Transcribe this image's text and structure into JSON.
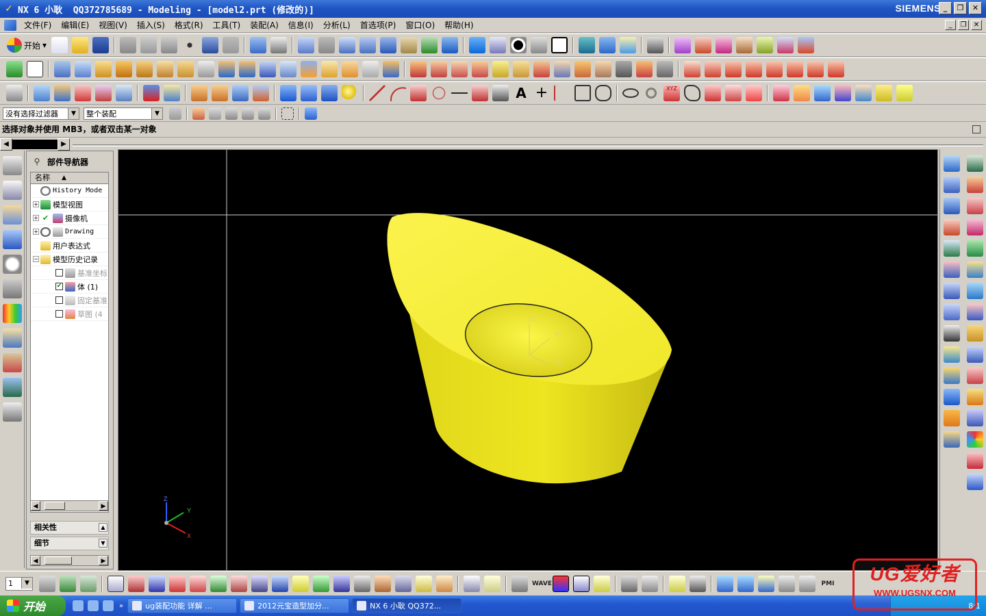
{
  "window": {
    "title": "NX 6 小耿  QQ372785689 - Modeling - [model2.prt (修改的)]",
    "brand": "SIEMENS",
    "controls": {
      "minimize": "_",
      "restore": "❐",
      "close": "✕"
    }
  },
  "menu": {
    "items": [
      "文件(F)",
      "编辑(E)",
      "视图(V)",
      "插入(S)",
      "格式(R)",
      "工具(T)",
      "装配(A)",
      "信息(I)",
      "分析(L)",
      "首选项(P)",
      "窗口(O)",
      "帮助(H)"
    ]
  },
  "toolbar": {
    "start_label": "开始",
    "start_arrow": "▾"
  },
  "selection": {
    "filter_value": "没有选择过滤器",
    "scope_value": "整个装配"
  },
  "cue_line": "选择对象并使用 MB3，或者双击某一对象",
  "navigator": {
    "title": "部件导航器",
    "column_name": "名称",
    "sort_glyph": "▲",
    "nodes": [
      {
        "label": "History Mode",
        "expander": ""
      },
      {
        "label": "模型视图",
        "expander": "+"
      },
      {
        "label": "摄像机",
        "expander": "+"
      },
      {
        "label": "Drawing",
        "expander": "+"
      },
      {
        "label": "用户表达式",
        "expander": ""
      },
      {
        "label": "模型历史记录",
        "expander": "−"
      },
      {
        "label": "基准坐标",
        "checked": false
      },
      {
        "label": "体 (1)",
        "checked": true
      },
      {
        "label": "固定基准",
        "checked": false
      },
      {
        "label": "草图 (4",
        "checked": false
      }
    ],
    "panels": [
      "相关性",
      "细节"
    ]
  },
  "viewport": {
    "wcs_labels": {
      "zc": "ZC",
      "yc": "YC",
      "xc": "XC"
    },
    "triad_labels": {
      "z": "Z",
      "y": "Y",
      "x": "X"
    },
    "colors": {
      "background": "#000000",
      "body": "#f2ea1c",
      "body_shadow": "#b8ae12"
    }
  },
  "bottom_toolbar": {
    "layer_value": "1",
    "wave_label": "WAVE",
    "pmi_label": "PMI"
  },
  "taskbar": {
    "start_label": "开始",
    "tasks": [
      {
        "label": "ug装配功能 详解 ...",
        "active": false
      },
      {
        "label": "2012元宝造型加分...",
        "active": false
      },
      {
        "label": "NX 6 小耿  QQ372...",
        "active": true
      }
    ],
    "clock": "8:1"
  },
  "watermark": {
    "title": "UG爱好者",
    "url": "WWW.UGSNX.COM"
  }
}
